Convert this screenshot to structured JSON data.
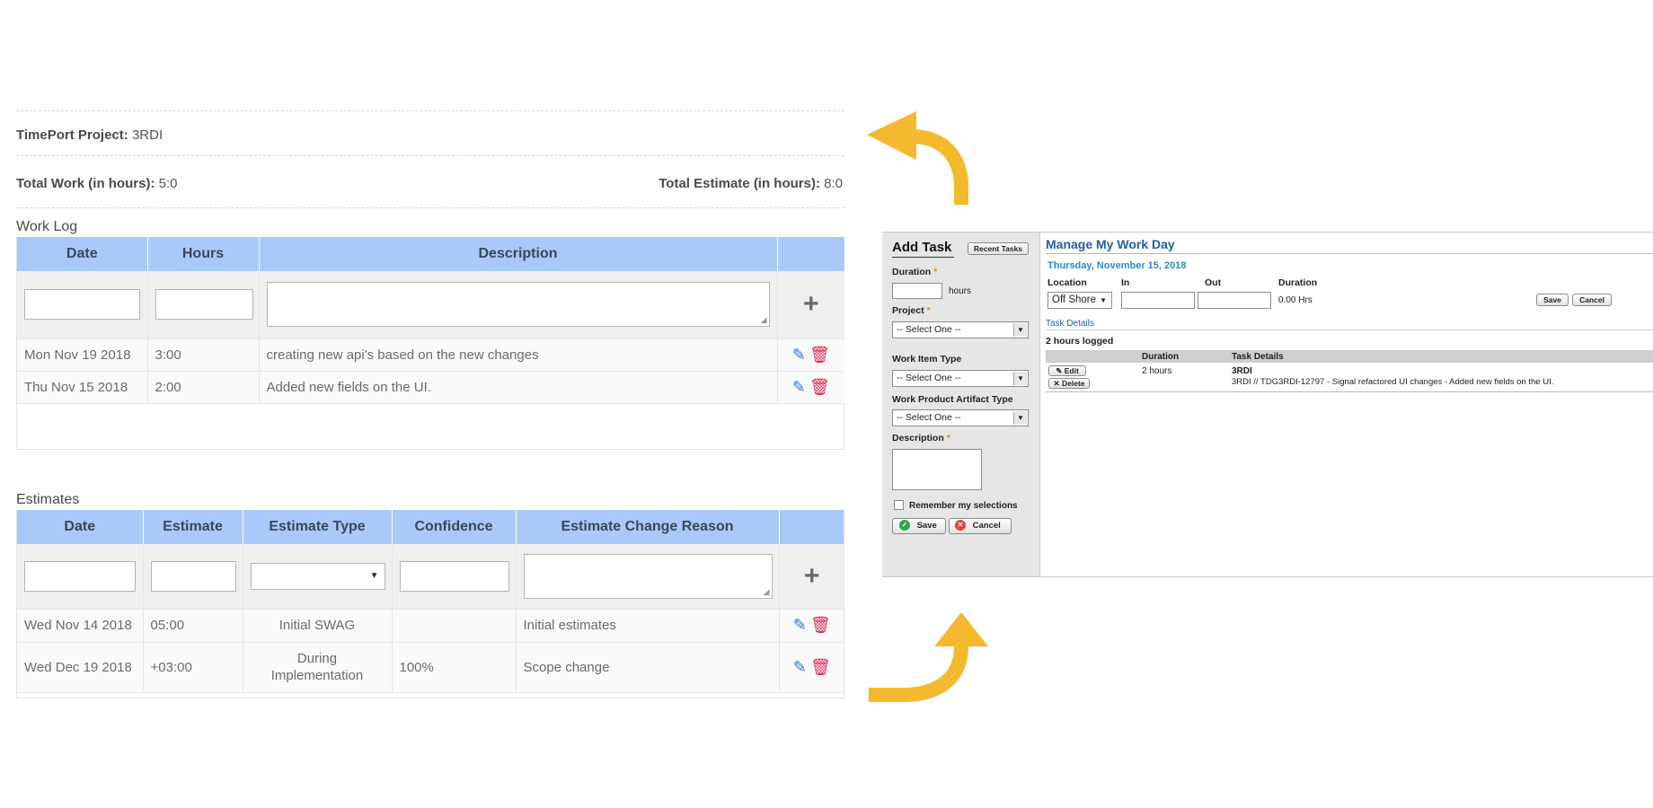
{
  "project": {
    "label": "TimePort Project:",
    "value": "3RDI"
  },
  "totals": {
    "work_label": "Total Work (in hours):",
    "work_value": "5:0",
    "estimate_label": "Total Estimate (in hours):",
    "estimate_value": "8:0"
  },
  "worklog": {
    "title": "Work Log",
    "columns": [
      "Date",
      "Hours",
      "Description"
    ],
    "rows": [
      {
        "date": "Mon Nov 19 2018",
        "hours": "3:00",
        "description": "creating new api's based on the new changes"
      },
      {
        "date": "Thu Nov 15 2018",
        "hours": "2:00",
        "description": "Added new fields on the UI."
      }
    ]
  },
  "estimates": {
    "title": "Estimates",
    "columns": [
      "Date",
      "Estimate",
      "Estimate Type",
      "Confidence",
      "Estimate Change Reason"
    ],
    "rows": [
      {
        "date": "Wed Nov 14 2018",
        "estimate": "05:00",
        "type": "Initial SWAG",
        "confidence": "",
        "reason": "Initial estimates"
      },
      {
        "date": "Wed Dec 19 2018",
        "estimate": "+03:00",
        "type": "During Implementation",
        "confidence": "100%",
        "reason": "Scope change"
      }
    ]
  },
  "add_task": {
    "title": "Add Task",
    "recent_button": "Recent Tasks",
    "duration_label": "Duration",
    "hours_unit": "hours",
    "project_label": "Project",
    "project_select": "-- Select One --",
    "work_item_label": "Work Item Type",
    "work_item_select": "-- Select One --",
    "artifact_label": "Work Product Artifact Type",
    "artifact_select": "-- Select One --",
    "description_label": "Description",
    "remember_label": "Remember my selections",
    "save": "Save",
    "cancel": "Cancel"
  },
  "manage": {
    "title": "Manage My Work Day",
    "date": "Thursday, November 15, 2018",
    "location_label": "Location",
    "in_label": "In",
    "out_label": "Out",
    "duration_label": "Duration",
    "location_value": "Off Shore",
    "duration_value": "0.00 Hrs",
    "save": "Save",
    "cancel": "Cancel",
    "task_details_link": "Task Details",
    "logged": "2 hours logged",
    "table_headers": [
      "Duration",
      "Task Details"
    ],
    "edit": "Edit",
    "delete": "Delete",
    "row_duration": "2 hours",
    "row_project": "3RDI",
    "row_detail": "3RDI // TDG3RDI-12797 - Signal refactored UI changes - Added new fields on the UI."
  },
  "colors": {
    "arrow": "#f4b92e",
    "header_blue": "#a9c9fa",
    "link_blue": "#1f5fa6",
    "plus_green": "#1a9e56",
    "trash_red": "#e0264e"
  }
}
